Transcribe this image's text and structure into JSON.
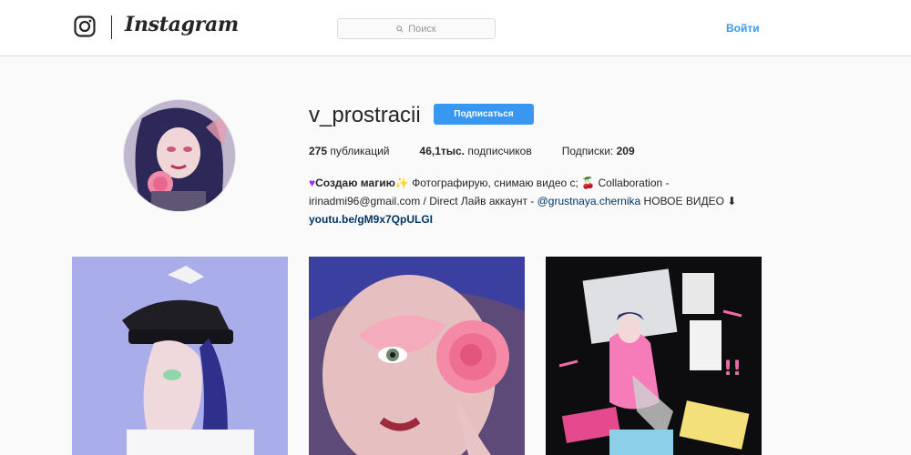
{
  "header": {
    "brand": "Instagram",
    "logo_icon": "camera-glyph-icon",
    "search": {
      "placeholder": "Поиск",
      "icon": "search-icon"
    },
    "login_label": "Войти",
    "accent_color": "#3897f0"
  },
  "profile": {
    "username": "v_prostracii",
    "follow_label": "Подписаться",
    "stats": {
      "posts_count": "275",
      "posts_label": "публикаций",
      "followers_count": "46,1тыс.",
      "followers_label": "подписчиков",
      "following_label": "Подписки:",
      "following_count": "209"
    },
    "bio": {
      "name": "Создаю магию",
      "line1_rest": " Фотографирую, снимаю видео с; 🍒 Collaboration -",
      "line2_email": "irinadmi96@gmail.com / Direct Лайв аккаунт - ",
      "mention": "@grustnaya.chernika",
      "line2_tail": " НОВОЕ ВИДЕО ⬇",
      "link": "youtu.be/gM9x7QpULGI"
    }
  },
  "posts": [
    {
      "subject": "portrait-with-sailor-cap"
    },
    {
      "subject": "closeup-with-pink-rose"
    },
    {
      "subject": "girl-with-pink-hoodie-and-magazines"
    }
  ]
}
